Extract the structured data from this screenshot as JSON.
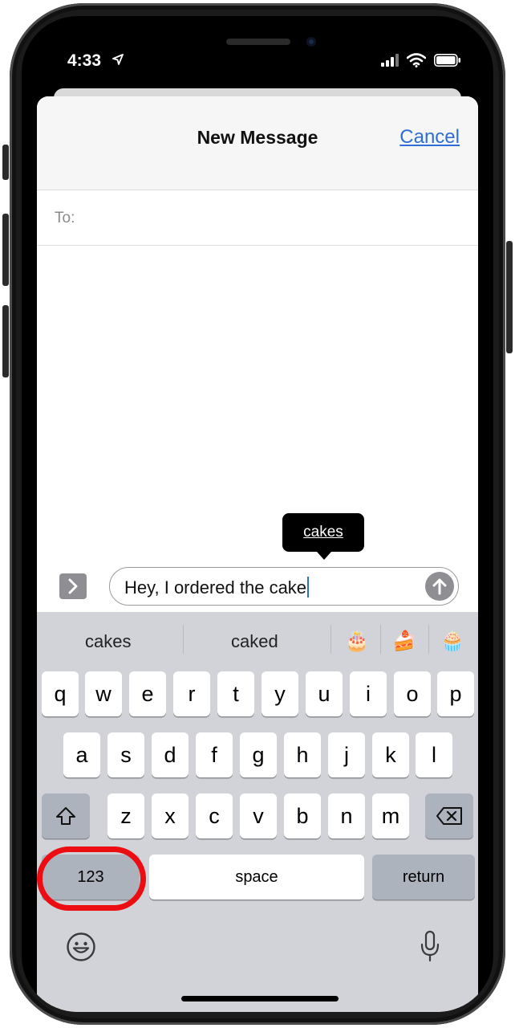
{
  "status": {
    "time": "4:33"
  },
  "header": {
    "title": "New Message",
    "cancel_label": "Cancel"
  },
  "to_field": {
    "label": "To:"
  },
  "autocorrect_bubble": {
    "text": "cakes"
  },
  "compose": {
    "text": "Hey, I ordered the cake"
  },
  "suggestions": {
    "words": [
      "cakes",
      "caked"
    ],
    "emojis": [
      "🎂",
      "🍰",
      "🧁"
    ]
  },
  "keyboard": {
    "row1": [
      "q",
      "w",
      "e",
      "r",
      "t",
      "y",
      "u",
      "i",
      "o",
      "p"
    ],
    "row2": [
      "a",
      "s",
      "d",
      "f",
      "g",
      "h",
      "j",
      "k",
      "l"
    ],
    "row3": [
      "z",
      "x",
      "c",
      "v",
      "b",
      "n",
      "m"
    ],
    "numbers_label": "123",
    "space_label": "space",
    "return_label": "return"
  },
  "colors": {
    "accent": "#2f6ed4",
    "highlight": "#ec0d12",
    "keyboard_bg": "#d1d3d9"
  }
}
